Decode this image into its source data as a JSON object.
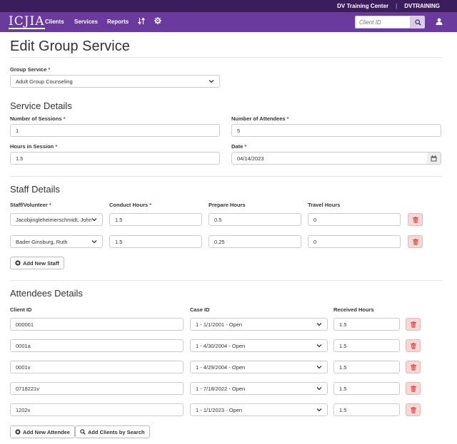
{
  "topbar": {
    "org": "DV Training Center",
    "separator": "|",
    "account": "DVTRAINING"
  },
  "nav": {
    "logo": "ICJIA",
    "items": [
      "Clients",
      "Services",
      "Reports"
    ],
    "search_placeholder": "Client ID"
  },
  "page": {
    "title": "Edit Group Service"
  },
  "group_service": {
    "label": "Group Service",
    "value": "Adult Group Counseling"
  },
  "service_details": {
    "title": "Service Details",
    "sessions": {
      "label": "Number of Sessions",
      "value": "1"
    },
    "attendees": {
      "label": "Number of Attendees",
      "value": "5"
    },
    "hours": {
      "label": "Hours in Session",
      "value": "1.5"
    },
    "date": {
      "label": "Date",
      "value": "04/14/2023"
    }
  },
  "staff_details": {
    "title": "Staff Details",
    "columns": [
      "Staff/Volunteer",
      "Conduct Hours",
      "Prepare Hours",
      "Travel Hours"
    ],
    "rows": [
      {
        "staff": "Jacobjingleheimerschmidt, John",
        "conduct": "1.5",
        "prepare": "0.5",
        "travel": "0"
      },
      {
        "staff": "Bader Ginsburg, Ruth",
        "conduct": "1.5",
        "prepare": "0.25",
        "travel": "0"
      }
    ],
    "add_label": "Add New Staff"
  },
  "attendees_details": {
    "title": "Attendees Details",
    "columns": [
      "Client ID",
      "Case ID",
      "Received Hours"
    ],
    "rows": [
      {
        "client": "000001",
        "case": "1 - 1/1/2001 - Open",
        "hours": "1.5"
      },
      {
        "client": "0001a",
        "case": "1 - 4/30/2004 - Open",
        "hours": "1.5"
      },
      {
        "client": "0001v",
        "case": "1 - 4/29/2004 - Open",
        "hours": "1.5"
      },
      {
        "client": "0718221v",
        "case": "1 - 7/18/2022 - Open",
        "hours": "1.5"
      },
      {
        "client": "1202v",
        "case": "1 - 1/1/2023 - Open",
        "hours": "1.5"
      }
    ],
    "add_label": "Add New Attendee",
    "search_label": "Add Clients by Search"
  },
  "icons": {
    "sort": "sort-icon",
    "settings": "gear-icon",
    "search": "search-icon",
    "user": "user-icon",
    "calendar": "calendar-icon",
    "trash": "trash-icon",
    "plus": "plus-circle-icon"
  }
}
